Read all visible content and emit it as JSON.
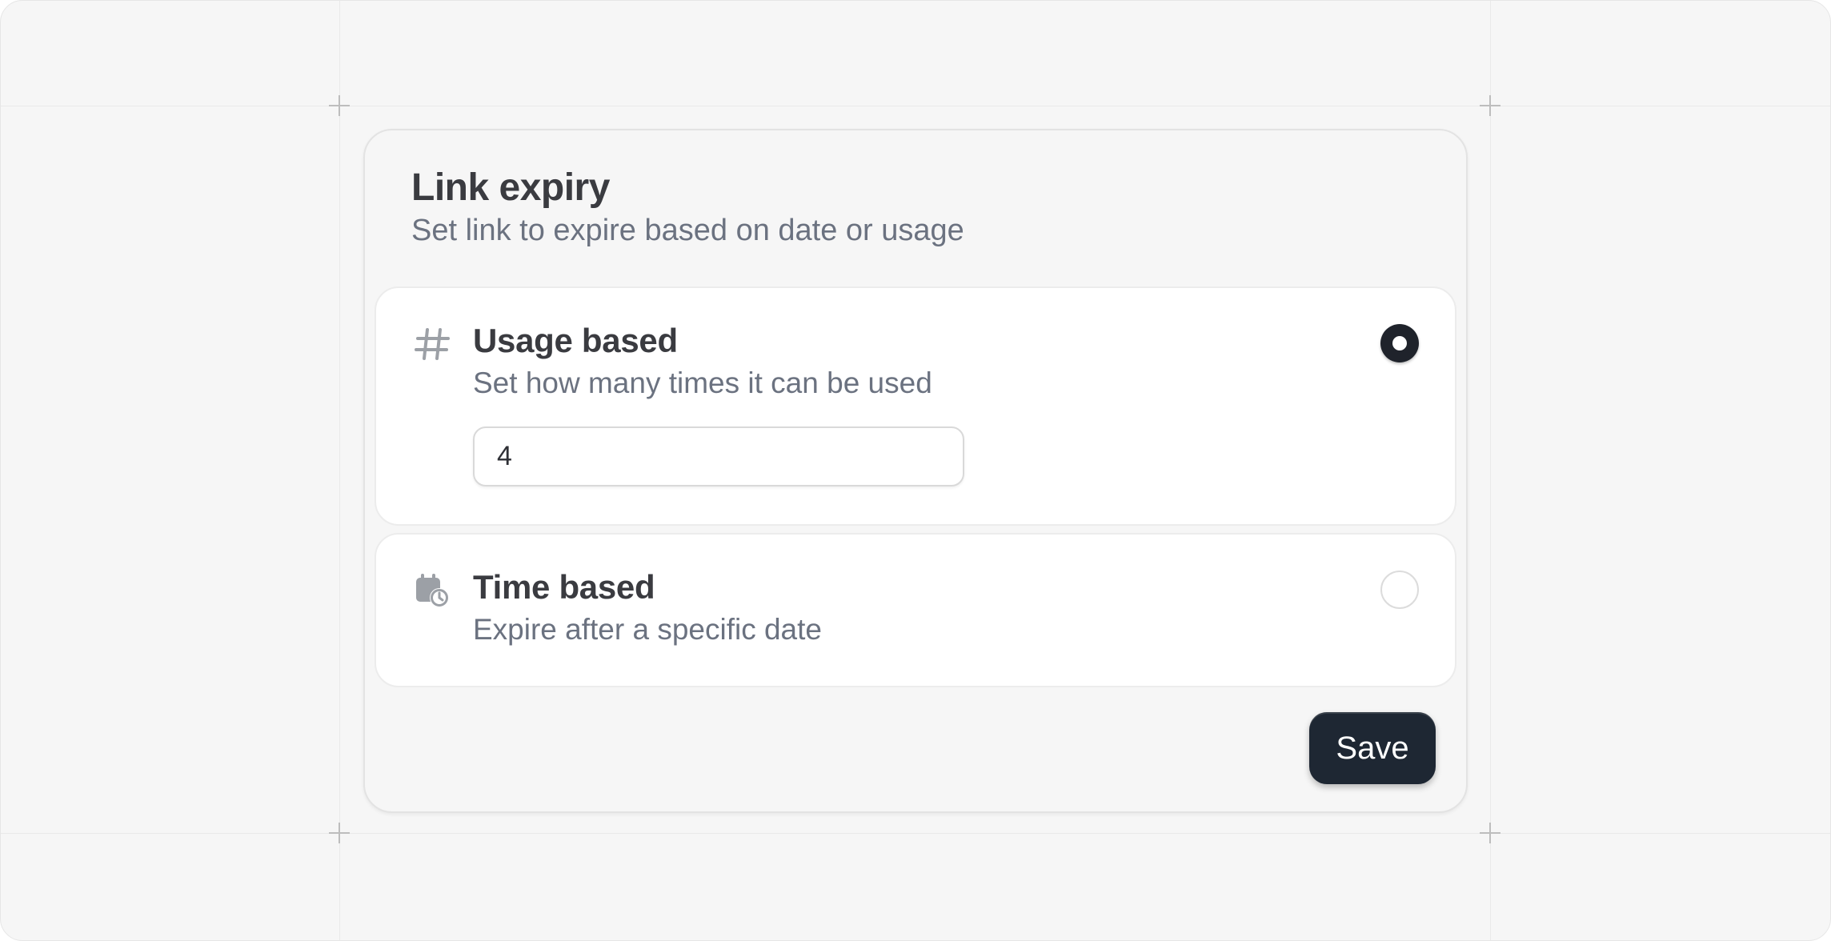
{
  "panel": {
    "title": "Link expiry",
    "subtitle": "Set link to expire based on date or usage"
  },
  "options": [
    {
      "icon": "hash-icon",
      "title": "Usage based",
      "description": "Set how many times it can be used",
      "selected": true,
      "input_value": "4"
    },
    {
      "icon": "calendar-clock-icon",
      "title": "Time based",
      "description": "Expire after a specific date",
      "selected": false
    }
  ],
  "actions": {
    "save_label": "Save"
  },
  "colors": {
    "background": "#f6f6f6",
    "card": "#ffffff",
    "primary_button": "#1e2733",
    "heading_text": "#3a3b40",
    "muted_text": "#6b7280"
  }
}
